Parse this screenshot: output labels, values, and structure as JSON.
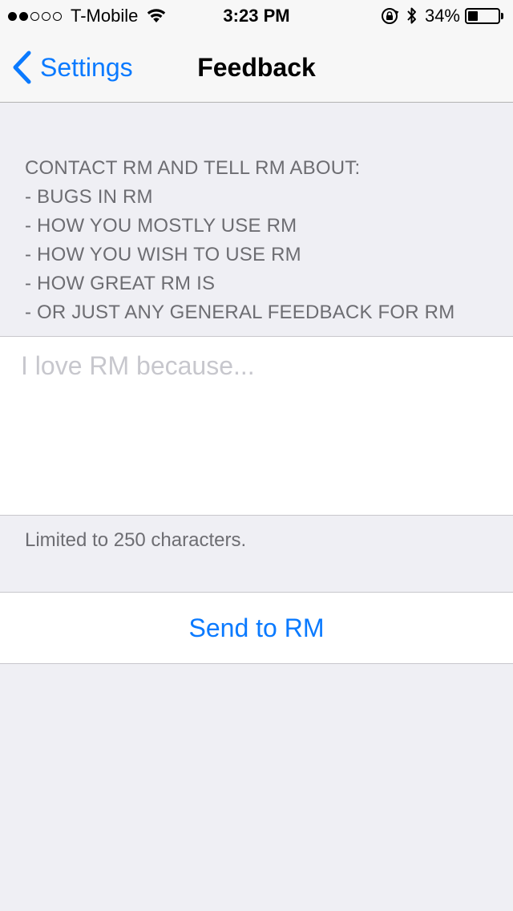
{
  "status_bar": {
    "carrier": "T-Mobile",
    "signal_bars_filled": 2,
    "signal_bars_total": 5,
    "time": "3:23 PM",
    "battery_percent": "34%",
    "battery_level": 0.34
  },
  "nav": {
    "back_label": "Settings",
    "title": "Feedback"
  },
  "instructions": {
    "lines": [
      "CONTACT RM AND TELL RM ABOUT:",
      "- BUGS IN RM",
      "- HOW YOU MOSTLY USE RM",
      "- HOW YOU WISH TO USE RM",
      "- HOW GREAT RM IS",
      "- OR JUST ANY GENERAL FEEDBACK FOR RM"
    ]
  },
  "feedback_field": {
    "value": "",
    "placeholder": "I love RM because..."
  },
  "limit_note": "Limited to 250 characters.",
  "send_button": {
    "label": "Send to RM"
  },
  "colors": {
    "accent": "#0a7aff",
    "background": "#efeff4",
    "secondary_text": "#6d6d72",
    "placeholder": "#c7c7cd"
  },
  "icons": {
    "wifi": "wifi-icon",
    "orientation_lock": "orientation-lock-icon",
    "bluetooth": "bluetooth-icon",
    "battery": "battery-icon",
    "back": "chevron-left-icon"
  }
}
